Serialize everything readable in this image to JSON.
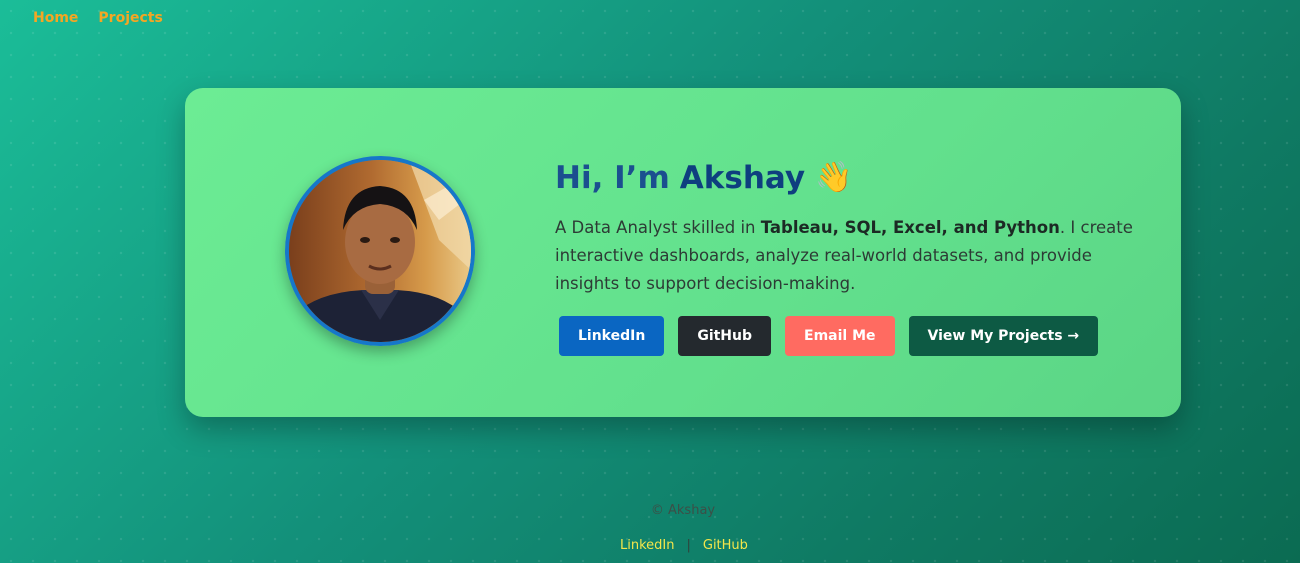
{
  "nav": {
    "items": [
      {
        "label": "Home"
      },
      {
        "label": "Projects"
      }
    ]
  },
  "hero": {
    "greeting": "Hi, I’m",
    "name": "Akshay",
    "wave_emoji": "👋",
    "bio": {
      "prefix": "A Data Analyst skilled in ",
      "skills": "Tableau, SQL, Excel, and Python",
      "suffix": ". I create interactive dashboards, analyze real-world datasets, and provide insights to support decision-making."
    },
    "buttons": {
      "linkedin": "LinkedIn",
      "github": "GitHub",
      "email": "Email Me",
      "projects": "View My Projects →"
    }
  },
  "footer": {
    "copyright": "© Akshay",
    "links": [
      {
        "label": "LinkedIn"
      },
      {
        "label": "GitHub"
      }
    ],
    "separator": "|"
  },
  "colors": {
    "nav_link": "#f5a623",
    "card_bg": "#6cec94",
    "heading": "#1b4f8f",
    "linkedin": "#0a66c2",
    "github": "#24292e",
    "email": "#ff6b61",
    "projects": "#0d5a44",
    "footer_link": "#f4e64a"
  }
}
